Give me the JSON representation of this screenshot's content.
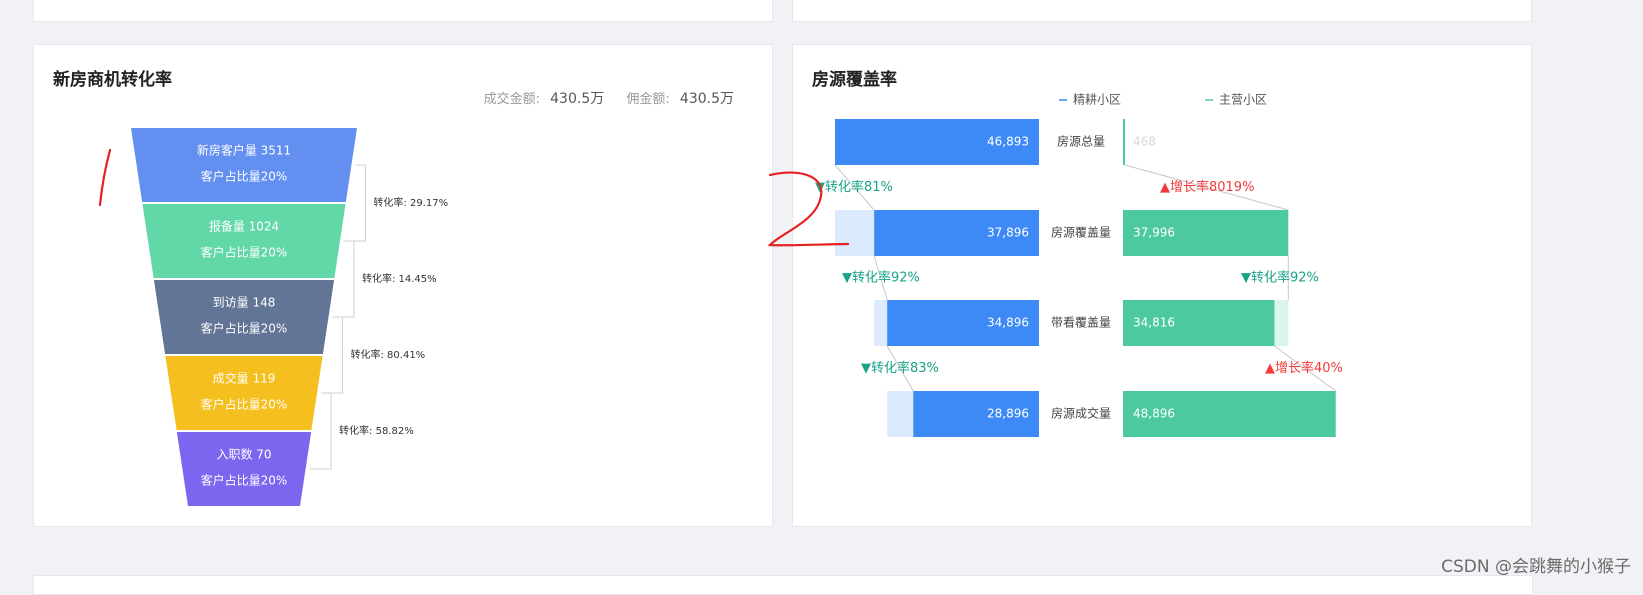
{
  "funnel_card": {
    "title": "新房商机转化率",
    "deal_amount_label": "成交金额:",
    "deal_amount_value": "430.5万",
    "commission_label": "佣金额:",
    "commission_value": "430.5万"
  },
  "coverage_card": {
    "title": "房源覆盖率"
  },
  "watermark": "CSDN @会跳舞的小猴子",
  "chart_data": [
    {
      "type": "funnel",
      "title": "新房商机转化率",
      "stages": [
        {
          "name": "新房客户量",
          "value": 3511,
          "label": "新房客户量 3511",
          "share_label": "客户占比量20%",
          "color": "#6390f0"
        },
        {
          "name": "报备量",
          "value": 1024,
          "label": "报备量 1024",
          "share_label": "客户占比量20%",
          "color": "#62d7a8"
        },
        {
          "name": "到访量",
          "value": 148,
          "label": "到访量 148",
          "share_label": "客户占比量20%",
          "color": "#627596"
        },
        {
          "name": "成交量",
          "value": 119,
          "label": "成交量 119",
          "share_label": "客户占比量20%",
          "color": "#f5bf1f"
        },
        {
          "name": "入职数",
          "value": 70,
          "label": "入职数 70",
          "share_label": "客户占比量20%",
          "color": "#7b66f0"
        }
      ],
      "conversions": [
        "转化率: 29.17%",
        "转化率: 14.45%",
        "转化率: 80.41%",
        "转化率: 58.82%"
      ]
    },
    {
      "type": "bar",
      "title": "房源覆盖率",
      "categories": [
        "房源总量",
        "房源覆盖量",
        "带看覆盖量",
        "房源成交量"
      ],
      "legend": [
        "精耕小区",
        "主营小区"
      ],
      "legend_colors": [
        "#3d8af7",
        "#4cc99e"
      ],
      "series": [
        {
          "name": "精耕小区",
          "values": [
            46893,
            37896,
            34896,
            28896
          ],
          "labels": [
            "46,893",
            "37,896",
            "34,896",
            "28,896"
          ],
          "color": "#3d8af7",
          "ghost_color": "#dceafd"
        },
        {
          "name": "主营小区",
          "values": [
            468,
            37996,
            34816,
            48896
          ],
          "labels": [
            "468",
            "37,996",
            "34,816",
            "48,896"
          ],
          "color": "#4cc99e",
          "ghost_color": "#daf6ec"
        }
      ],
      "left_rates": [
        "▼转化率81%",
        "▼转化率92%",
        "▼转化率83%"
      ],
      "right_rates": [
        "▲增长率8019%",
        "▼转化率92%",
        "▲增长率40%"
      ],
      "rate_colors": {
        "down": "#18a388",
        "up": "#f23b3b"
      }
    }
  ]
}
